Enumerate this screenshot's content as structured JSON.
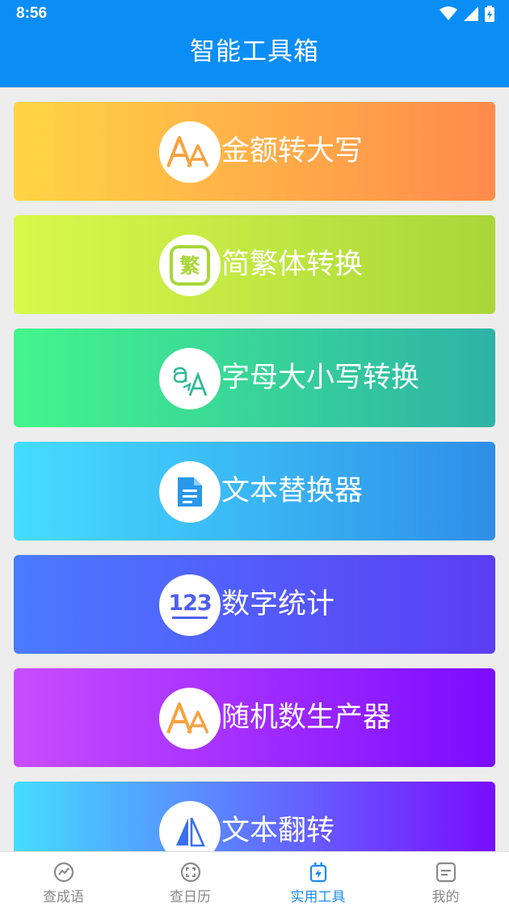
{
  "status": {
    "time": "8:56"
  },
  "header": {
    "title": "智能工具箱"
  },
  "tools": [
    {
      "label": "金额转大写",
      "icon": "font-aa-icon",
      "gradient": [
        "#ffd544",
        "#ff8a4c"
      ],
      "icon_color": "#f7a23f"
    },
    {
      "label": "简繁体转换",
      "icon": "traditional-char-icon",
      "icon_text": "繁",
      "gradient": [
        "#d9f94a",
        "#a9d63a"
      ],
      "icon_color": "#a9d63a"
    },
    {
      "label": "字母大小写转换",
      "icon": "letter-case-icon",
      "gradient": [
        "#44f58c",
        "#2db3a6"
      ],
      "icon_color": "#2db99a"
    },
    {
      "label": "文本替换器",
      "icon": "document-icon",
      "gradient": [
        "#45ddff",
        "#2f8ee8"
      ],
      "icon_color": "#2a97e8"
    },
    {
      "label": "数字统计",
      "icon": "number-123-icon",
      "icon_text": "123",
      "gradient": [
        "#4a7bff",
        "#5c3df5"
      ],
      "icon_color": "#4f5ef0"
    },
    {
      "label": "随机数生产器",
      "icon": "font-aa-icon",
      "gradient": [
        "#c94dff",
        "#7a0cff"
      ],
      "icon_color": "#f7a23f"
    },
    {
      "label": "文本翻转",
      "icon": "flip-icon",
      "gradient": [
        "#45ddff",
        "#7a0cff"
      ],
      "icon_color": "#3a6ff0"
    }
  ],
  "tabs": [
    {
      "label": "查成语",
      "icon": "trend-circle-icon",
      "active": false
    },
    {
      "label": "查日历",
      "icon": "scan-calendar-icon",
      "active": false
    },
    {
      "label": "实用工具",
      "icon": "charge-tool-icon",
      "active": true
    },
    {
      "label": "我的",
      "icon": "profile-note-icon",
      "active": false
    }
  ],
  "colors": {
    "appbar": "#0a8ef6",
    "tab_active": "#1a8cf0",
    "tab_inactive": "#8a8a8a"
  }
}
